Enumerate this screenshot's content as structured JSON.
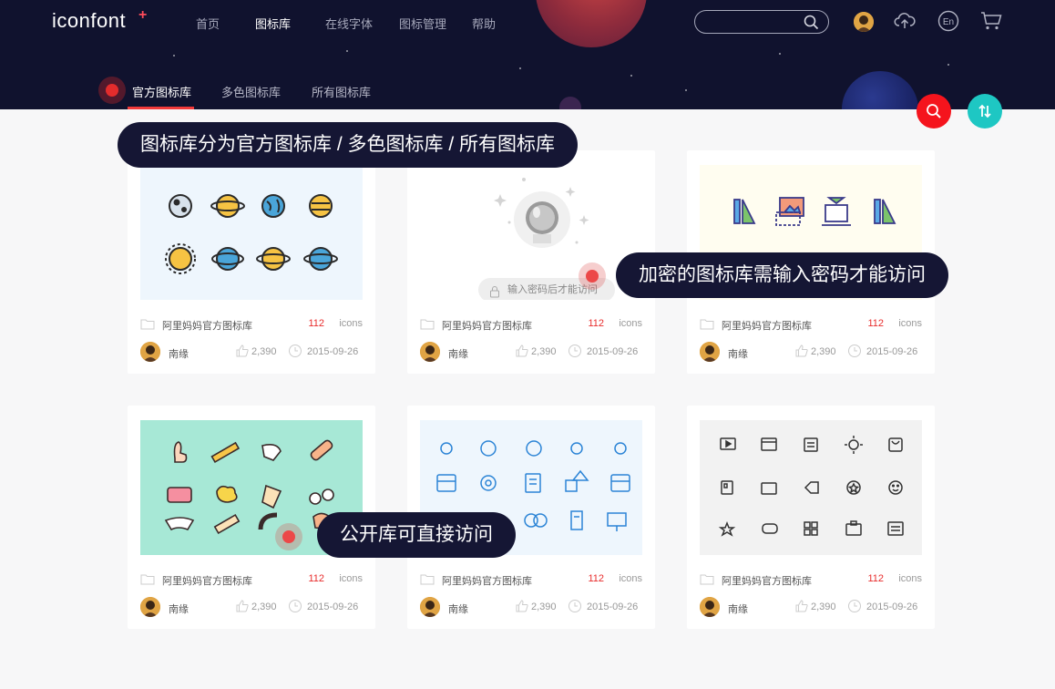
{
  "header": {
    "logo": "iconfont",
    "logo_mark": "+",
    "nav": [
      {
        "label": "首页"
      },
      {
        "label": "图标库"
      },
      {
        "label": "在线字体"
      },
      {
        "label": "图标管理"
      },
      {
        "label": "帮助"
      }
    ],
    "search_placeholder": "",
    "icons": [
      "user-avatar",
      "upload-icon",
      "language-en-icon",
      "cart-icon"
    ],
    "lang_label": "En"
  },
  "subnav": {
    "tabs": [
      {
        "label": "官方图标库",
        "active": true
      },
      {
        "label": "多色图标库",
        "active": false
      },
      {
        "label": "所有图标库",
        "active": false
      }
    ]
  },
  "tooltips": {
    "library_types": "图标库分为官方图标库 / 多色图标库 / 所有图标库",
    "encrypted": "加密的图标库需输入密码才能访问",
    "public": "公开库可直接访问"
  },
  "password_prompt": "输入密码后才能访问",
  "cards": [
    {
      "name": "阿里妈妈官方图标库",
      "count": "112",
      "unit": "icons",
      "author": "南缘",
      "likes": "2,390",
      "date": "2015-09-26",
      "theme": "planets"
    },
    {
      "name": "阿里妈妈官方图标库",
      "count": "112",
      "unit": "icons",
      "author": "南缘",
      "likes": "2,390",
      "date": "2015-09-26",
      "theme": "locked"
    },
    {
      "name": "阿里妈妈官方图标库",
      "count": "112",
      "unit": "icons",
      "author": "南缘",
      "likes": "2,390",
      "date": "2015-09-26",
      "theme": "office"
    },
    {
      "name": "阿里妈妈官方图标库",
      "count": "112",
      "unit": "icons",
      "author": "南缘",
      "likes": "2,390",
      "date": "2015-09-26",
      "theme": "hand-drawn"
    },
    {
      "name": "阿里妈妈官方图标库",
      "count": "112",
      "unit": "icons",
      "author": "南缘",
      "likes": "2,390",
      "date": "2015-09-26",
      "theme": "blue-line"
    },
    {
      "name": "阿里妈妈官方图标库",
      "count": "112",
      "unit": "icons",
      "author": "南缘",
      "likes": "2,390",
      "date": "2015-09-26",
      "theme": "dark-line"
    }
  ],
  "colors": {
    "header_bg": "#10122e",
    "accent_red": "#f5141d",
    "accent_teal": "#1ec7c3",
    "count_red": "#e82b2b"
  }
}
